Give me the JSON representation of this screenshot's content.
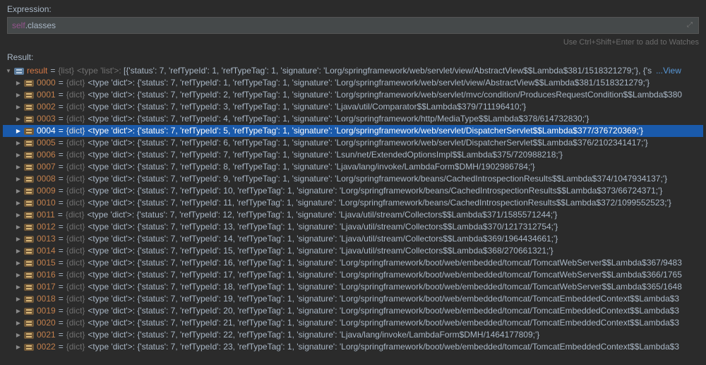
{
  "expression": {
    "label": "Expression:",
    "value_self": "self",
    "value_attr": ".classes",
    "hint": "Use Ctrl+Shift+Enter to add to Watches"
  },
  "result": {
    "label": "Result:",
    "root_name": "result",
    "root_type": "{list}",
    "root_prefix": "<type 'list'>: ",
    "root_value": "[{'status': 7, 'refTypeId': 1, 'refTypeTag': 1, 'signature': 'Lorg/springframework/web/servlet/view/AbstractView$$Lambda$381/1518321279;'}, {'s",
    "view_link": "...View",
    "items": [
      {
        "index": "0000",
        "type": "{dict}",
        "value": "<type 'dict'>: {'status': 7, 'refTypeId': 1, 'refTypeTag': 1, 'signature': 'Lorg/springframework/web/servlet/view/AbstractView$$Lambda$381/1518321279;'}"
      },
      {
        "index": "0001",
        "type": "{dict}",
        "value": "<type 'dict'>: {'status': 7, 'refTypeId': 2, 'refTypeTag': 1, 'signature': 'Lorg/springframework/web/servlet/mvc/condition/ProducesRequestCondition$$Lambda$380"
      },
      {
        "index": "0002",
        "type": "{dict}",
        "value": "<type 'dict'>: {'status': 7, 'refTypeId': 3, 'refTypeTag': 1, 'signature': 'Ljava/util/Comparator$$Lambda$379/711196410;'}"
      },
      {
        "index": "0003",
        "type": "{dict}",
        "value": "<type 'dict'>: {'status': 7, 'refTypeId': 4, 'refTypeTag': 1, 'signature': 'Lorg/springframework/http/MediaType$$Lambda$378/614732830;'}"
      },
      {
        "index": "0004",
        "type": "{dict}",
        "value": "<type 'dict'>: {'status': 7, 'refTypeId': 5, 'refTypeTag': 1, 'signature': 'Lorg/springframework/web/servlet/DispatcherServlet$$Lambda$377/376720369;'}",
        "selected": true
      },
      {
        "index": "0005",
        "type": "{dict}",
        "value": "<type 'dict'>: {'status': 7, 'refTypeId': 6, 'refTypeTag': 1, 'signature': 'Lorg/springframework/web/servlet/DispatcherServlet$$Lambda$376/2102341417;'}"
      },
      {
        "index": "0006",
        "type": "{dict}",
        "value": "<type 'dict'>: {'status': 7, 'refTypeId': 7, 'refTypeTag': 1, 'signature': 'Lsun/net/ExtendedOptionsImpl$$Lambda$375/720988218;'}"
      },
      {
        "index": "0007",
        "type": "{dict}",
        "value": "<type 'dict'>: {'status': 7, 'refTypeId': 8, 'refTypeTag': 1, 'signature': 'Ljava/lang/invoke/LambdaForm$DMH/1902986784;'}"
      },
      {
        "index": "0008",
        "type": "{dict}",
        "value": "<type 'dict'>: {'status': 7, 'refTypeId': 9, 'refTypeTag': 1, 'signature': 'Lorg/springframework/beans/CachedIntrospectionResults$$Lambda$374/1047934137;'}"
      },
      {
        "index": "0009",
        "type": "{dict}",
        "value": "<type 'dict'>: {'status': 7, 'refTypeId': 10, 'refTypeTag': 1, 'signature': 'Lorg/springframework/beans/CachedIntrospectionResults$$Lambda$373/66724371;'}"
      },
      {
        "index": "0010",
        "type": "{dict}",
        "value": "<type 'dict'>: {'status': 7, 'refTypeId': 11, 'refTypeTag': 1, 'signature': 'Lorg/springframework/beans/CachedIntrospectionResults$$Lambda$372/1099552523;'}"
      },
      {
        "index": "0011",
        "type": "{dict}",
        "value": "<type 'dict'>: {'status': 7, 'refTypeId': 12, 'refTypeTag': 1, 'signature': 'Ljava/util/stream/Collectors$$Lambda$371/1585571244;'}"
      },
      {
        "index": "0012",
        "type": "{dict}",
        "value": "<type 'dict'>: {'status': 7, 'refTypeId': 13, 'refTypeTag': 1, 'signature': 'Ljava/util/stream/Collectors$$Lambda$370/1217312754;'}"
      },
      {
        "index": "0013",
        "type": "{dict}",
        "value": "<type 'dict'>: {'status': 7, 'refTypeId': 14, 'refTypeTag': 1, 'signature': 'Ljava/util/stream/Collectors$$Lambda$369/1964434661;'}"
      },
      {
        "index": "0014",
        "type": "{dict}",
        "value": "<type 'dict'>: {'status': 7, 'refTypeId': 15, 'refTypeTag': 1, 'signature': 'Ljava/util/stream/Collectors$$Lambda$368/270661321;'}"
      },
      {
        "index": "0015",
        "type": "{dict}",
        "value": "<type 'dict'>: {'status': 7, 'refTypeId': 16, 'refTypeTag': 1, 'signature': 'Lorg/springframework/boot/web/embedded/tomcat/TomcatWebServer$$Lambda$367/9483"
      },
      {
        "index": "0016",
        "type": "{dict}",
        "value": "<type 'dict'>: {'status': 7, 'refTypeId': 17, 'refTypeTag': 1, 'signature': 'Lorg/springframework/boot/web/embedded/tomcat/TomcatWebServer$$Lambda$366/1765"
      },
      {
        "index": "0017",
        "type": "{dict}",
        "value": "<type 'dict'>: {'status': 7, 'refTypeId': 18, 'refTypeTag': 1, 'signature': 'Lorg/springframework/boot/web/embedded/tomcat/TomcatWebServer$$Lambda$365/1648"
      },
      {
        "index": "0018",
        "type": "{dict}",
        "value": "<type 'dict'>: {'status': 7, 'refTypeId': 19, 'refTypeTag': 1, 'signature': 'Lorg/springframework/boot/web/embedded/tomcat/TomcatEmbeddedContext$$Lambda$3"
      },
      {
        "index": "0019",
        "type": "{dict}",
        "value": "<type 'dict'>: {'status': 7, 'refTypeId': 20, 'refTypeTag': 1, 'signature': 'Lorg/springframework/boot/web/embedded/tomcat/TomcatEmbeddedContext$$Lambda$3"
      },
      {
        "index": "0020",
        "type": "{dict}",
        "value": "<type 'dict'>: {'status': 7, 'refTypeId': 21, 'refTypeTag': 1, 'signature': 'Lorg/springframework/boot/web/embedded/tomcat/TomcatEmbeddedContext$$Lambda$3"
      },
      {
        "index": "0021",
        "type": "{dict}",
        "value": "<type 'dict'>: {'status': 7, 'refTypeId': 22, 'refTypeTag': 1, 'signature': 'Ljava/lang/invoke/LambdaForm$DMH/1464177809;'}"
      },
      {
        "index": "0022",
        "type": "{dict}",
        "value": "<type 'dict'>: {'status': 7, 'refTypeId': 23, 'refTypeTag': 1, 'signature': 'Lorg/springframework/boot/web/embedded/tomcat/TomcatEmbeddedContext$$Lambda$3"
      }
    ]
  }
}
